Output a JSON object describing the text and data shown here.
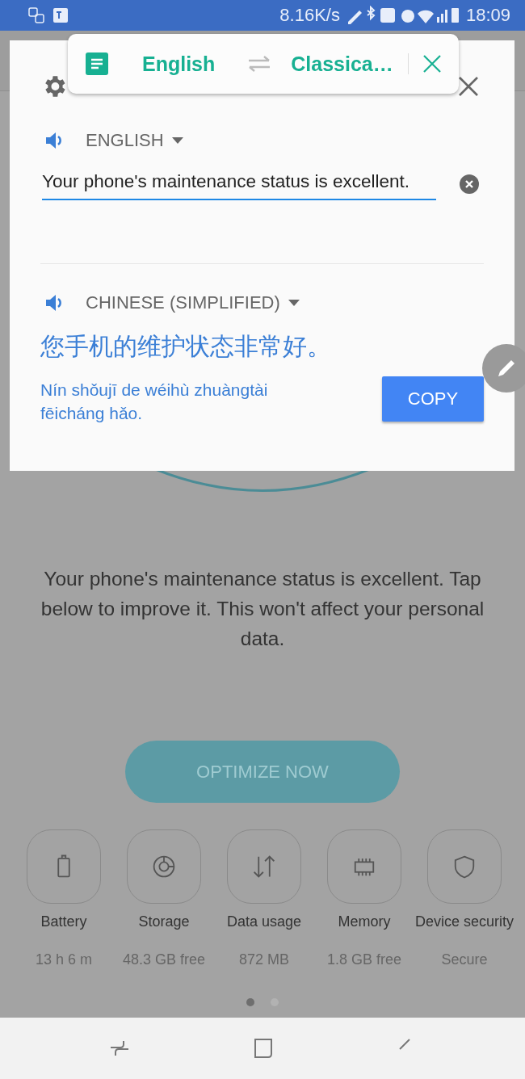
{
  "status_bar": {
    "speed": "8.16K/s",
    "time": "18:09"
  },
  "translate_bar": {
    "source": "English",
    "target": "Classica…"
  },
  "dialog": {
    "source_language": "ENGLISH",
    "input": "Your phone's maintenance status is excellent.",
    "target_language": "CHINESE (SIMPLIFIED)",
    "translation": "您手机的维护状态非常好。",
    "romanization": "Nín shǒujī de wéihù zhuàngtài fēicháng hǎo.",
    "copy": "COPY"
  },
  "background": {
    "message": "Your phone's maintenance status is excellent. Tap below to improve it. This won't affect your personal data.",
    "button": "OPTIMIZE NOW",
    "tools": [
      {
        "kind": "battery",
        "label": "Battery",
        "value": "13 h 6 m"
      },
      {
        "kind": "storage",
        "label": "Storage",
        "value": "48.3 GB free"
      },
      {
        "kind": "data",
        "label": "Data usage",
        "value": "872 MB"
      },
      {
        "kind": "memory",
        "label": "Memory",
        "value": "1.8 GB free"
      },
      {
        "kind": "security",
        "label": "Device security",
        "value": "Secure"
      }
    ],
    "page_dots": [
      {
        "selected": true
      },
      {
        "selected": false
      }
    ]
  }
}
